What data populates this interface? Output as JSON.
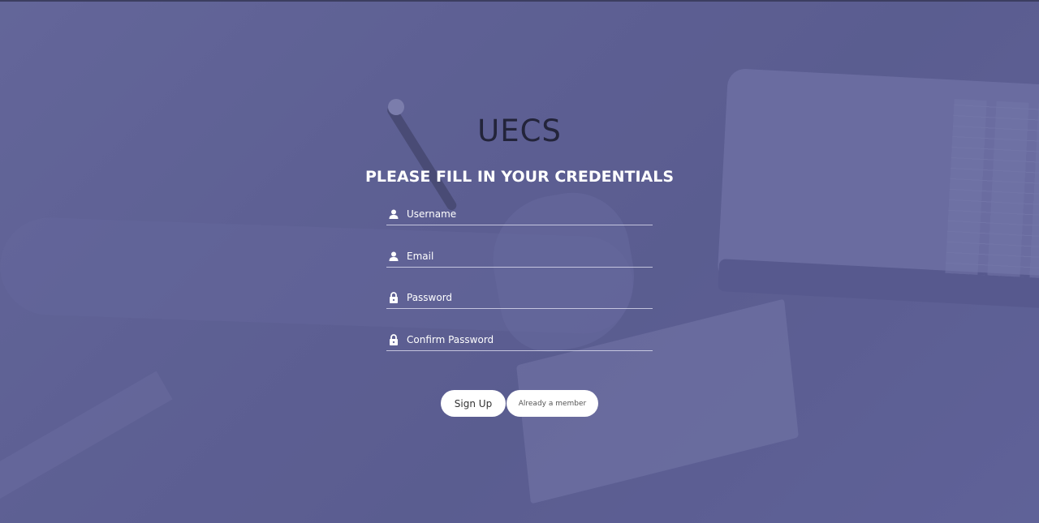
{
  "brand": {
    "title": "UECS"
  },
  "form": {
    "heading": "PLEASE FILL IN YOUR CREDENTIALS",
    "fields": [
      {
        "icon": "user-icon",
        "placeholder": "Username",
        "value": ""
      },
      {
        "icon": "user-icon",
        "placeholder": "Email",
        "value": ""
      },
      {
        "icon": "lock-icon",
        "placeholder": "Password",
        "value": ""
      },
      {
        "icon": "lock-icon",
        "placeholder": "Confirm Password",
        "value": ""
      }
    ],
    "buttons": {
      "signup_label": "Sign Up",
      "member_label": "Already a member"
    }
  },
  "colors": {
    "background_tint": "#5d5f91",
    "heading": "#ffffff",
    "brand": "#23243a",
    "button_bg": "#ffffff"
  }
}
